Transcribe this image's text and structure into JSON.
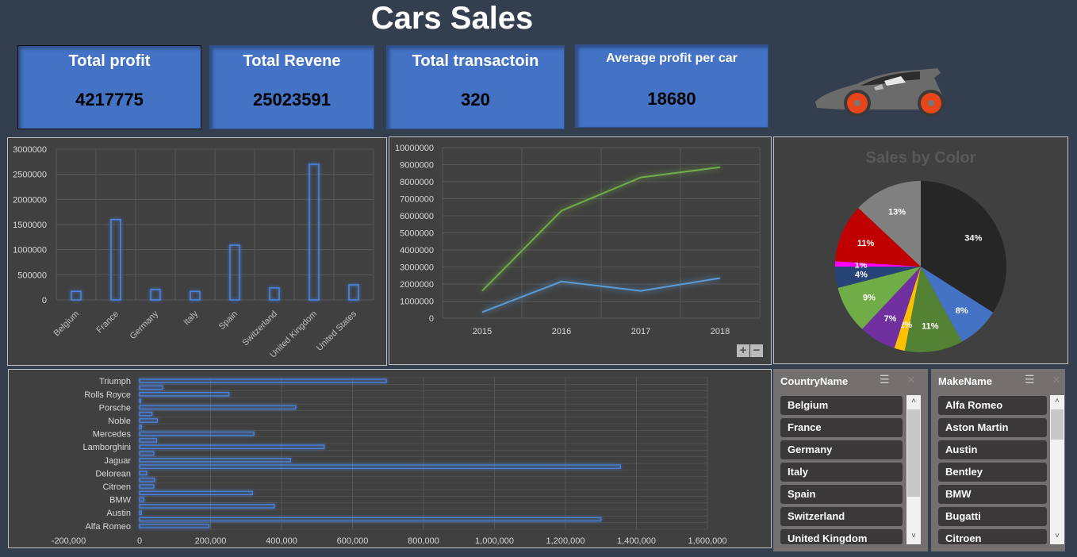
{
  "title": "Cars Sales",
  "kpis": [
    {
      "label": "Total profit",
      "value": "4217775"
    },
    {
      "label": "Total Revene",
      "value": "25023591"
    },
    {
      "label": "Total transactoin",
      "value": "320"
    },
    {
      "label": "Average profit per car",
      "value": "18680"
    }
  ],
  "chart_data": [
    {
      "type": "bar",
      "categories": [
        "Belgium",
        "France",
        "Germany",
        "Italy",
        "Spain",
        "Switzerland",
        "United Kingdom",
        "United States"
      ],
      "values": [
        170000,
        1600000,
        210000,
        170000,
        1090000,
        240000,
        2700000,
        300000
      ],
      "ylim": [
        0,
        3000000
      ],
      "yticks": [
        "0",
        "500000",
        "1000000",
        "1500000",
        "2000000",
        "2500000",
        "3000000"
      ],
      "grid": true,
      "color": "#4a86e8"
    },
    {
      "type": "line",
      "x": [
        "2015",
        "2016",
        "2017",
        "2018"
      ],
      "series": [
        {
          "values": [
            1600000,
            6300000,
            8250000,
            8850000
          ],
          "color": "#70ad47"
        },
        {
          "values": [
            350000,
            2150000,
            1600000,
            2350000
          ],
          "color": "#5b9bd5"
        }
      ],
      "ylim": [
        0,
        10000000
      ],
      "yticks": [
        "0",
        "1000000",
        "2000000",
        "3000000",
        "4000000",
        "5000000",
        "6000000",
        "7000000",
        "8000000",
        "9000000",
        "10000000"
      ],
      "grid": true
    },
    {
      "type": "pie",
      "title": "Sales by Color",
      "values": [
        34,
        8,
        11,
        2,
        7,
        9,
        4,
        1,
        11,
        13
      ],
      "labels": [
        "34%",
        "8%",
        "11%",
        "2%",
        "7%",
        "9%",
        "4%",
        "1%",
        "11%",
        "13%"
      ],
      "colors": [
        "#262626",
        "#4472c4",
        "#548235",
        "#ffc000",
        "#7030a0",
        "#70ad47",
        "#264478",
        "#ff00ff",
        "#c00000",
        "#808080"
      ]
    },
    {
      "type": "bar",
      "orientation": "horizontal",
      "categories": [
        "Alfa Romeo",
        "",
        "Austin",
        "",
        "BMW",
        "",
        "Citroen",
        "",
        "Delorean",
        "",
        "Jaguar",
        "",
        "Lamborghini",
        "",
        "Mercedes",
        "",
        "Noble",
        "",
        "Porsche",
        "",
        "Rolls Royce",
        "",
        "Triumph"
      ],
      "values": [
        195000,
        1300000,
        5000,
        380000,
        12000,
        318000,
        40000,
        42000,
        20000,
        1355000,
        425000,
        40000,
        520000,
        48000,
        322000,
        5000,
        50000,
        35000,
        440000,
        3000,
        252000,
        65000,
        695000
      ],
      "xlim": [
        -200000,
        1600000
      ],
      "xticks": [
        "-200,000",
        "0",
        "200,000",
        "400,000",
        "600,000",
        "800,000",
        "1,000,000",
        "1,200,000",
        "1,400,000",
        "1,600,000"
      ],
      "grid": true,
      "color": "#4a86e8"
    }
  ],
  "zoom_controls": {
    "plus": "+",
    "minus": "−"
  },
  "slicers": [
    {
      "header": "CountryName",
      "items": [
        "Belgium",
        "France",
        "Germany",
        "Italy",
        "Spain",
        "Switzerland",
        "United Kingdom"
      ]
    },
    {
      "header": "MakeName",
      "items": [
        "Alfa Romeo",
        "Aston Martin",
        "Austin",
        "Bentley",
        "BMW",
        "Bugatti",
        "Citroen"
      ]
    }
  ],
  "icons": {
    "multi_select": "☰",
    "clear_filter": "⨯",
    "scroll_up": "˄",
    "scroll_down": "˅"
  }
}
